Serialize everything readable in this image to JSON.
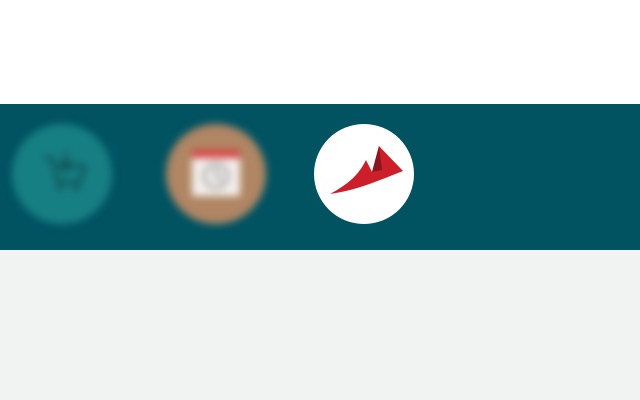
{
  "top_area": {},
  "app_bar": {
    "background_color": "#015362",
    "apps": [
      {
        "icon": "shopping-cart-icon",
        "state": "blurred",
        "color": "#167f84"
      },
      {
        "icon": "calendar-clock-icon",
        "state": "blurred",
        "color": "#b08664"
      },
      {
        "icon": "red-flyer-logo-icon",
        "state": "active",
        "color": "#ffffff",
        "mark_color": "#cc1f2a"
      }
    ]
  },
  "bottom_area": {
    "background_color": "#f1f2f2"
  }
}
